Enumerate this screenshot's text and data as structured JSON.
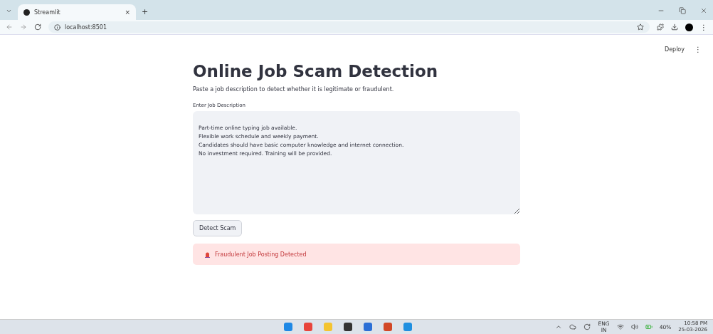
{
  "browser": {
    "tab_title": "Streamlit",
    "tab_close": "×",
    "new_tab": "+",
    "url": "localhost:8501"
  },
  "header": {
    "deploy": "Deploy",
    "menu": "⋮"
  },
  "page": {
    "title": "Online Job Scam Detection",
    "subtitle": "Paste a job description to detect whether it is legitimate or fraudulent.",
    "field_label": "Enter Job Description",
    "field_value": "Part-time online typing job available.\nFlexible work schedule and weekly payment.\nCandidates should have basic computer knowledge and internet connection.\nNo investment required. Training will be provided.",
    "button": "Detect Scam",
    "alert": {
      "kind": "error",
      "text": "Fraudulent Job Posting Detected"
    }
  },
  "taskbar": {
    "language": "ENG",
    "region": "IN",
    "battery": "40%",
    "time": "10:58 PM",
    "date": "25-03-2026"
  }
}
